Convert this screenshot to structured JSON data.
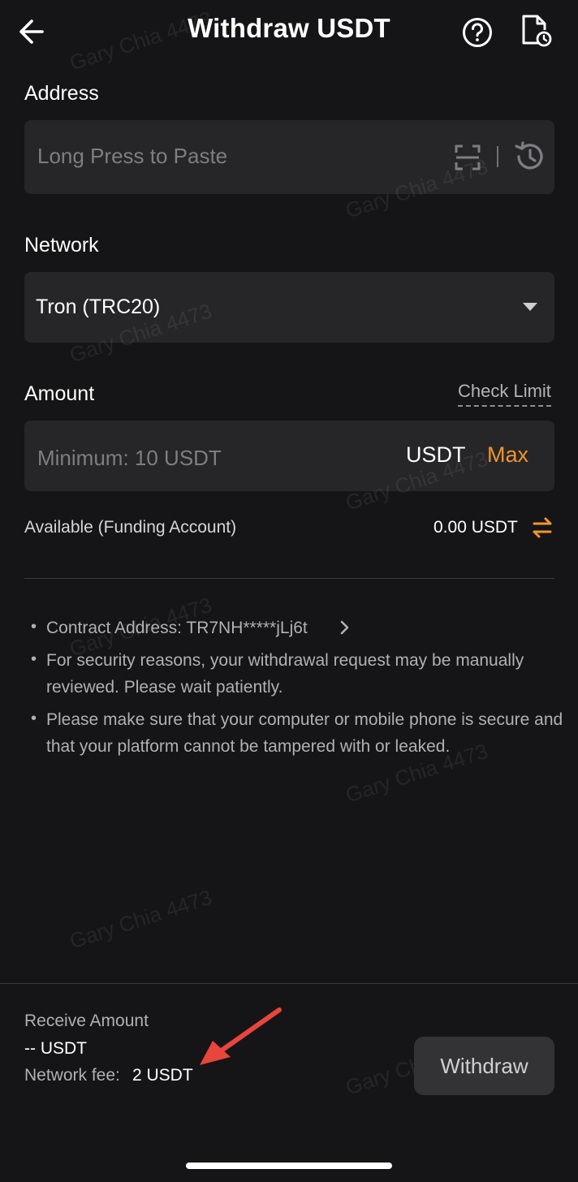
{
  "header": {
    "title": "Withdraw USDT",
    "back_icon": "arrow-left-icon",
    "help_icon": "question-circle-icon",
    "records_icon": "document-clock-icon"
  },
  "address": {
    "label": "Address",
    "placeholder": "Long Press to Paste",
    "scan_icon": "scan-icon",
    "history_icon": "history-icon"
  },
  "network": {
    "label": "Network",
    "value": "Tron (TRC20)"
  },
  "amount": {
    "label": "Amount",
    "check_limit": "Check Limit",
    "placeholder": "Minimum: 10 USDT",
    "unit": "USDT",
    "max": "Max",
    "available_label": "Available (Funding Account)",
    "available_value": "0.00 USDT"
  },
  "notes": [
    "Contract Address: TR7NH*****jLj6t",
    "For security reasons, your withdrawal request may be manually reviewed. Please wait patiently.",
    "Please make sure that your computer or mobile phone is secure and that your platform cannot be tampered with or leaked."
  ],
  "footer": {
    "receive_label": "Receive Amount",
    "receive_value": "-- USDT",
    "fee_label": "Network fee:",
    "fee_value": "2 USDT",
    "withdraw_button": "Withdraw"
  },
  "watermark": "Gary Chia 4473",
  "colors": {
    "background": "#151517",
    "field": "#262628",
    "accent": "#f0952a",
    "annotation_arrow": "#e8453c"
  }
}
